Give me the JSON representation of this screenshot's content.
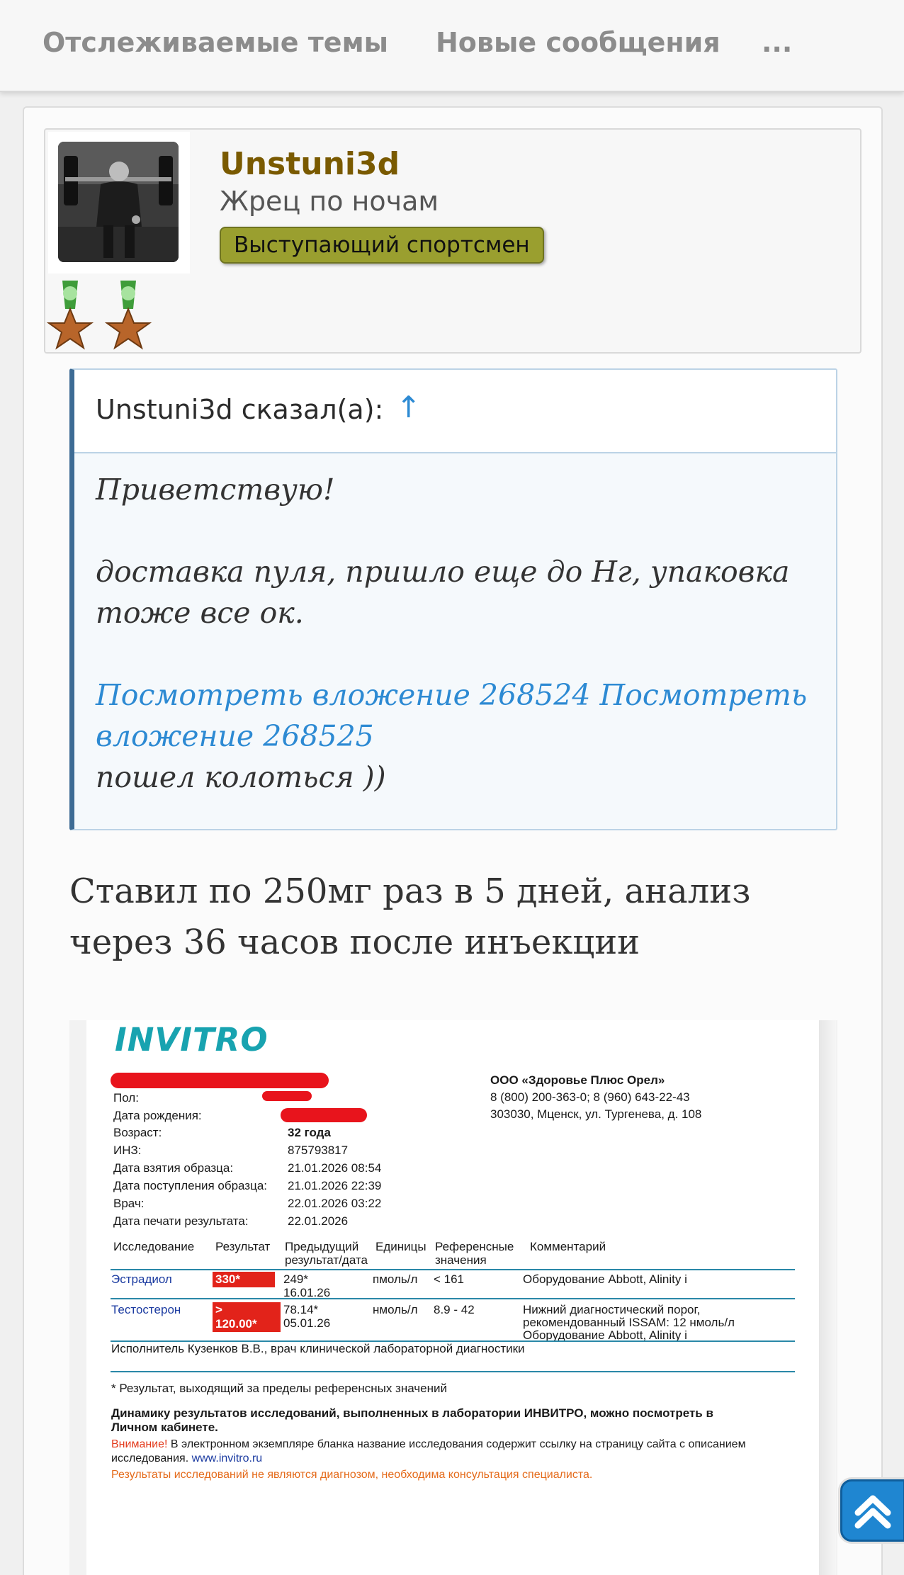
{
  "nav": {
    "items": [
      "Отслеживаемые темы",
      "Новые сообщения"
    ],
    "more": "..."
  },
  "user": {
    "name": "Unstuni3d",
    "title": "Жрец по ночам",
    "badge": "Выступающий спортсмен"
  },
  "quote": {
    "author_line": "Unstuni3d сказал(а):",
    "arrow": "↑",
    "greeting": "Приветствую!",
    "line1": "доставка пуля, пришло еще до Нг, упаковка тоже все ок.",
    "attachments": "Посмотреть вложение 268524 Посмотреть вложение 268525",
    "line2": "пошел колоться ))"
  },
  "post": {
    "text": "Ставил по 250мг раз в 5 дней, анализ через 36 часов после инъекции"
  },
  "lab": {
    "logo": "INVITRO",
    "fields": [
      {
        "label": "Пол:",
        "value": ""
      },
      {
        "label": "Дата рождения:",
        "value": ""
      },
      {
        "label": "Возраст:",
        "value": "32 года"
      },
      {
        "label": "ИНЗ:",
        "value": "875793817"
      },
      {
        "label": "Дата взятия образца:",
        "value": "21.01.2026 08:54"
      },
      {
        "label": "Дата поступления образца:",
        "value": "21.01.2026 22:39"
      },
      {
        "label": "Врач:",
        "value": "22.01.2026 03:22"
      },
      {
        "label": "Дата печати результата:",
        "value": "22.01.2026"
      }
    ],
    "org": {
      "name": "ООО «Здоровье Плюс Орел»",
      "phones": "8 (800) 200-363-0; 8 (960) 643-22-43",
      "address": "303030, Мценск, ул. Тургенева, д. 108"
    },
    "headers": {
      "study": "Исследование",
      "result": "Результат",
      "prev1": "Предыдущий",
      "prev2": "результат/дата",
      "units": "Единицы",
      "ref1": "Референсные",
      "ref2": "значения",
      "comment": "Комментарий"
    },
    "rows": [
      {
        "name": "Эстрадиол",
        "result": "330*",
        "prev": "249*",
        "prev_date": "16.01.26",
        "units": "пмоль/л",
        "ref": "< 161",
        "comment": [
          "Оборудование Abbott, Alinity i"
        ]
      },
      {
        "name": "Тестостерон",
        "result1": ">",
        "result2": "120.00*",
        "prev": "78.14*",
        "prev_date": "05.01.26",
        "units": "нмоль/л",
        "ref": "8.9 - 42",
        "comment": [
          "Нижний диагностический порог,",
          "рекомендованный ISSAM: 12 нмоль/л",
          "Оборудование Abbott, Alinity i"
        ]
      }
    ],
    "executor": "Исполнитель Кузенков В.В., врач клинической лабораторной диагностики",
    "footnote": "* Результат, выходящий за пределы референсных значений",
    "dynamics": "Динамику результатов исследований, выполненных в лаборатории ИНВИТРО, можно посмотреть в Личном кабинете.",
    "dynamics1": "Динамику результатов исследований, выполненных в лаборатории ИНВИТРО, можно посмотреть в",
    "dynamics2": "Личном кабинете.",
    "warning_label": "Внимание!",
    "warning_text1": " В электронном экземпляре бланка название исследования содержит ссылку на страницу сайта с описанием",
    "warning_text2": "исследования.",
    "warning_link": "www.invitro.ru",
    "disclaimer": "Результаты исследований не являются диагнозом, необходима консультация специалиста."
  }
}
